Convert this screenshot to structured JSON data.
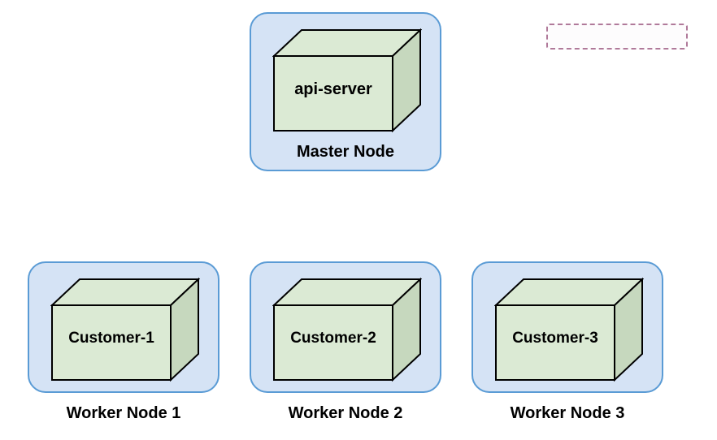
{
  "master": {
    "title": "Master Node",
    "cube_label": "api-server"
  },
  "workers": [
    {
      "title": "Worker Node 1",
      "cube_label": "Customer-1"
    },
    {
      "title": "Worker Node 2",
      "cube_label": "Customer-2"
    },
    {
      "title": "Worker Node 3",
      "cube_label": "Customer-3"
    }
  ],
  "colors": {
    "node_bg": "#d5e3f5",
    "node_border": "#5a9bd5",
    "cube_fill": "#dbead4",
    "cube_stroke": "#000000",
    "legend_border": "#b07a9a"
  }
}
